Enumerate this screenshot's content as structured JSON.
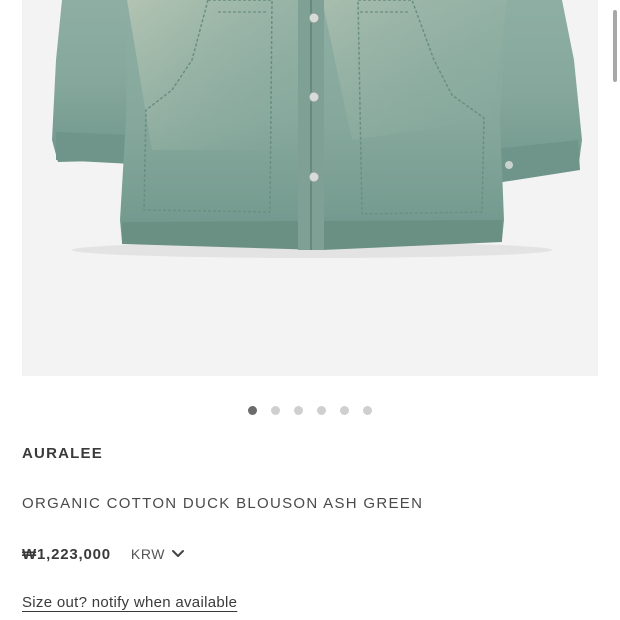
{
  "product": {
    "brand": "AURALEE",
    "title": "ORGANIC COTTON DUCK BLOUSON ASH GREEN",
    "price": "₩1,223,000",
    "currency": "KRW",
    "notify_label": "Size out? notify when available",
    "image_color": "#7fa39a"
  },
  "gallery": {
    "image_count": 6,
    "active_index": 0
  },
  "icons": {
    "currency_chevron": "chevron-down-icon"
  }
}
